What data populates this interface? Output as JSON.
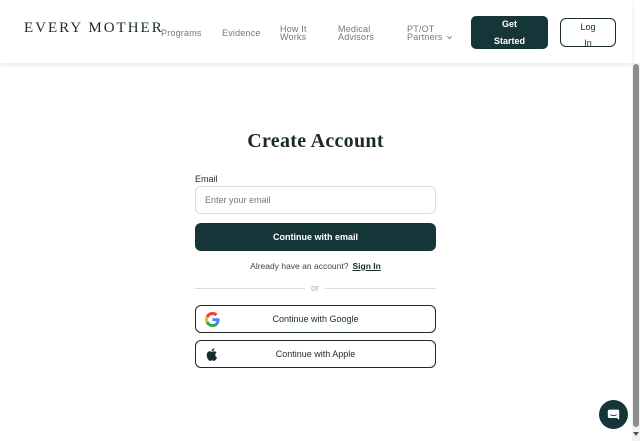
{
  "header": {
    "logo": "EVERY MOTHER",
    "nav": [
      {
        "lines": [
          "Programs"
        ]
      },
      {
        "lines": [
          "Evidence"
        ]
      },
      {
        "lines": [
          "How It",
          "Works"
        ]
      },
      {
        "lines": [
          "Medical",
          "Advisors"
        ]
      },
      {
        "lines": [
          "PT/OT",
          "Partners"
        ],
        "has_dropdown": true
      }
    ],
    "get_started": [
      "Get",
      "Started"
    ],
    "log_in": [
      "Log",
      "In"
    ]
  },
  "form": {
    "title": "Create Account",
    "email_label": "Email",
    "email_placeholder": "Enter your email",
    "email_value": "",
    "continue_email": "Continue with email",
    "already_account": "Already have an account?",
    "sign_in": "Sign In",
    "divider": "or",
    "continue_google": "Continue with Google",
    "continue_apple": "Continue with Apple"
  },
  "icons": {
    "google": "google-logo-icon",
    "apple": "apple-logo-icon",
    "chat": "chat-bubble-icon",
    "dropdown": "chevron-down-icon"
  },
  "colors": {
    "primary": "#163539",
    "text": "#1b2a2f",
    "muted": "#6f7a7e",
    "border": "#d7dcdd"
  }
}
